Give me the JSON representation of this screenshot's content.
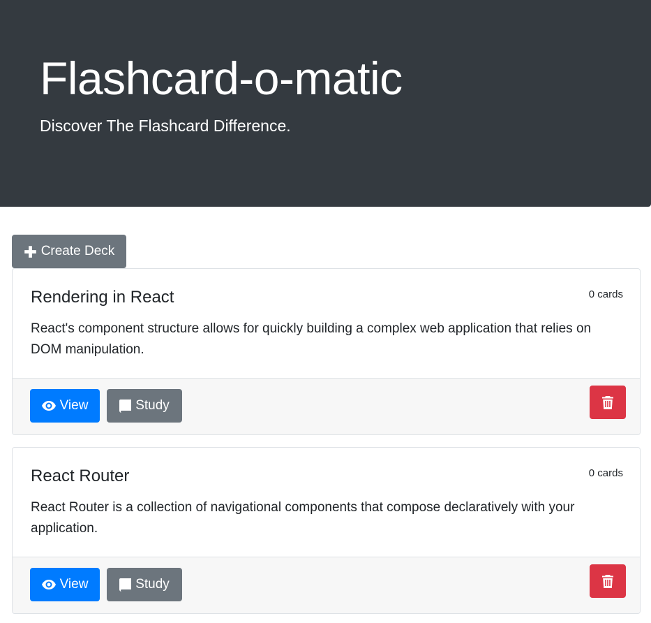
{
  "header": {
    "title": "Flashcard-o-matic",
    "subtitle": "Discover The Flashcard Difference."
  },
  "toolbar": {
    "create_deck_label": "Create Deck",
    "create_icon": "plus-icon"
  },
  "decks": [
    {
      "name": "Rendering in React",
      "card_count": "0 cards",
      "description": "React's component structure allows for quickly building a complex web application that relies on DOM manipulation.",
      "view_label": "View",
      "study_label": "Study"
    },
    {
      "name": "React Router",
      "card_count": "0 cards",
      "description": "React Router is a collection of navigational components that compose declaratively with your application.",
      "view_label": "View",
      "study_label": "Study"
    }
  ],
  "icons": {
    "view": "eye-icon",
    "study": "book-icon",
    "delete": "trash-icon"
  },
  "colors": {
    "header_bg": "#343a40",
    "primary": "#007bff",
    "secondary": "#6c757d",
    "danger": "#dc3545"
  }
}
